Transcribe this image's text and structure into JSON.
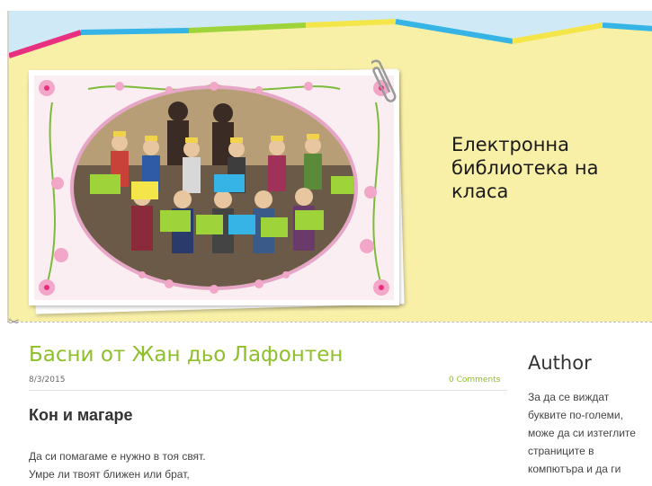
{
  "header": {
    "site_title": "Електронна библиотека на класа",
    "photo": "class-photo"
  },
  "post": {
    "title": "Басни от Жан дьо Лафонтен",
    "date": "8/3/2015",
    "comments": "0 Comments",
    "subtitle": "Кон и магаре",
    "lines": [
      "Да си помагаме е нужно в тоя свят.",
      "Умре ли твоят ближен или брат,"
    ]
  },
  "sidebar": {
    "title": "Author",
    "lines": [
      "За да се виждат",
      "буквите по-големи,",
      "може да си изтеглите",
      "страниците в",
      "компютъра и да ги"
    ]
  },
  "colors": {
    "header_bg": "#f9f0a8",
    "accent_green": "#8fbf2a",
    "stripe_pink": "#e8307e",
    "stripe_blue": "#36b4e6",
    "stripe_yellow": "#f4e64a"
  }
}
